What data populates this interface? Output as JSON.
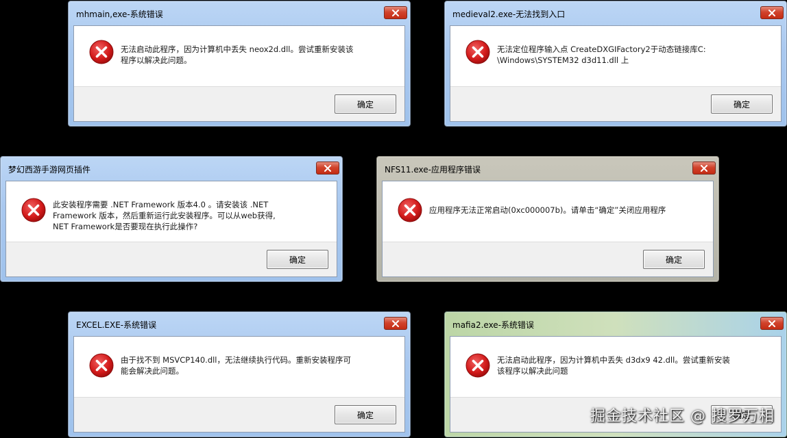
{
  "colors": {
    "close_button": "#c42c14",
    "error_icon": "#d21a1a",
    "button_area": "#f0f0f0"
  },
  "ok_label": "确定",
  "dialogs": [
    {
      "title": "mhmain,exe-系统错误",
      "lines": [
        "无法启动此程序，因为计算机中丢失 neox2d.dll。尝试重新安装该",
        "程序以解决此问题。"
      ],
      "button": "确定"
    },
    {
      "title": "medieval2.exe-无法找到入口",
      "lines": [
        "无法定位程序输入点 CreateDXGIFactory2于动态链接库C:",
        "\\Windows\\SYSTEM32 d3d11.dll 上"
      ],
      "button": "确定"
    },
    {
      "title": "梦幻西游手游网页插件",
      "lines": [
        "此安装程序需要 .NET Framework 版本4.0 。请安装该 .NET",
        "Framework 版本，然后重新运行此安装程序。可以从web获得,",
        "NET Framework是否要现在执行此操作?"
      ],
      "button": "确定"
    },
    {
      "title": "NFS11.exe-应用程序错误",
      "lines": [
        "应用程序无法正常启动(0xc000007b)。请单击“确定”关闭应用程序"
      ],
      "button": "确定"
    },
    {
      "title": "EXCEL.EXE-系统错误",
      "lines": [
        "由于找不到 MSVCP140.dll，无法继续执行代码。重新安装程序可",
        "能会解决此问题。"
      ],
      "button": "确定"
    },
    {
      "title": "mafia2.exe-系统错误",
      "lines": [
        "无法启动此程序，因为计算机中丢失 d3dx9 42.dll。尝试重新安装",
        "该程序以解决此问题"
      ],
      "button": "确定"
    }
  ],
  "watermark": "掘金技术社区 @ 搜罗万相"
}
